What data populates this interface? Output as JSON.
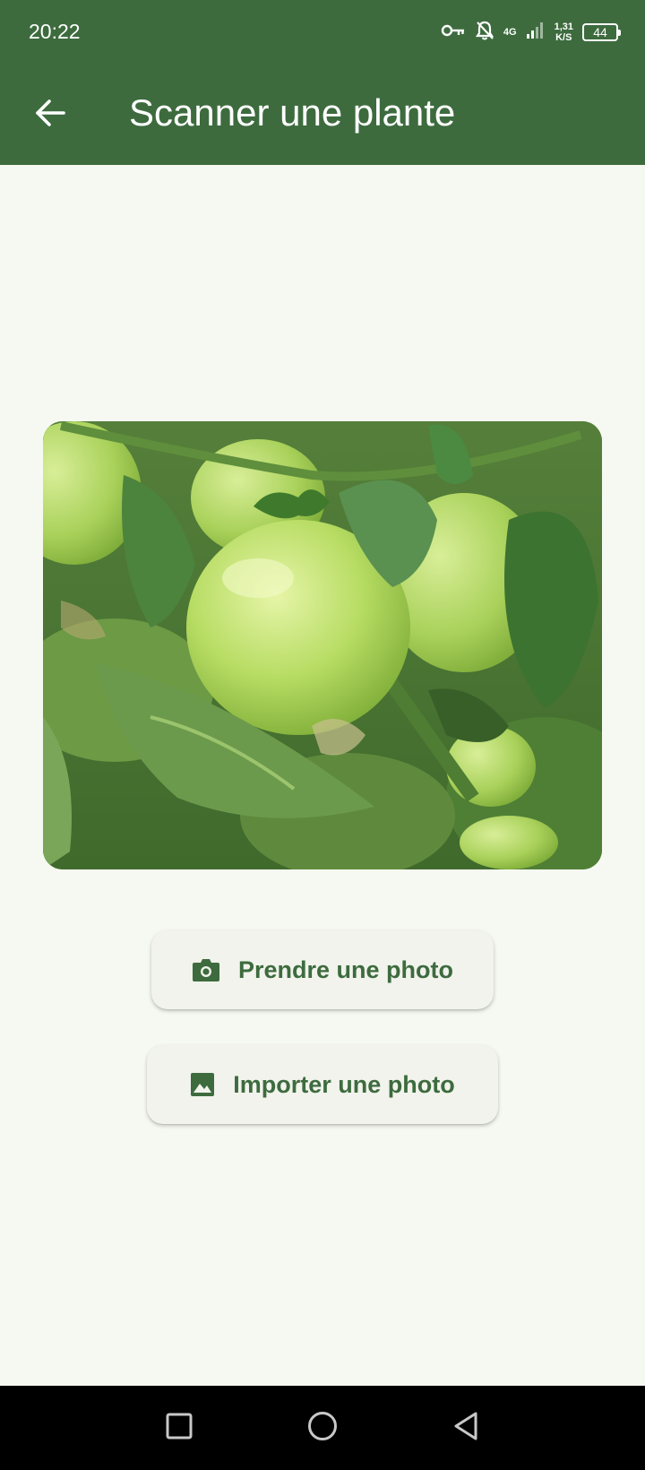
{
  "status_bar": {
    "time": "20:22",
    "network_type": "4G",
    "speed_value": "1,31",
    "speed_unit": "K/S",
    "battery": "44",
    "icons": [
      "key-icon",
      "bell-off-icon",
      "signal-icon",
      "battery-icon"
    ]
  },
  "app_bar": {
    "title": "Scanner une plante",
    "back_icon": "arrow-left-icon",
    "color": "#3d6b3e"
  },
  "preview": {
    "image": "green-tomatoes-on-plant"
  },
  "actions": {
    "take_photo_label": "Prendre une photo",
    "take_photo_icon": "camera-icon",
    "import_photo_label": "Importer une photo",
    "import_photo_icon": "image-icon"
  },
  "nav_bar": {
    "icons": [
      "recents-square-icon",
      "home-circle-icon",
      "back-triangle-icon"
    ]
  },
  "colors": {
    "primary": "#3d6b3e",
    "background": "#f6f9f1",
    "button_bg": "#f1f3ec"
  }
}
